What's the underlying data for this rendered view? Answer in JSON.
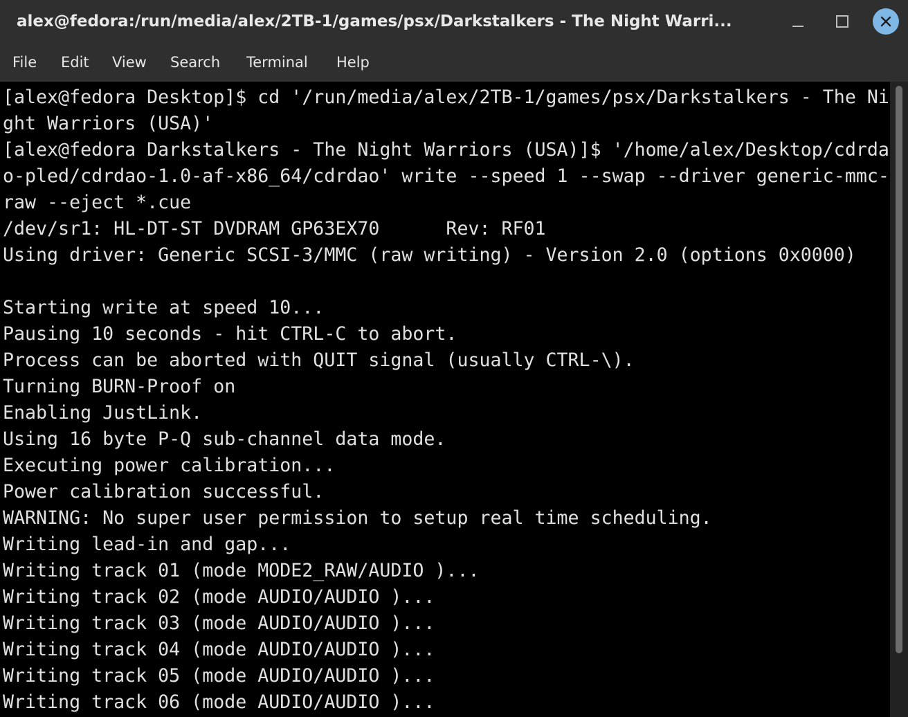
{
  "window": {
    "title": "alex@fedora:/run/media/alex/2TB-1/games/psx/Darkstalkers - The Night Warri..."
  },
  "menu": {
    "items": [
      "File",
      "Edit",
      "View",
      "Search",
      "Terminal",
      "Help"
    ]
  },
  "terminal": {
    "lines": [
      "[alex@fedora Desktop]$ cd '/run/media/alex/2TB-1/games/psx/Darkstalkers - The Ni",
      "ght Warriors (USA)'",
      "[alex@fedora Darkstalkers - The Night Warriors (USA)]$ '/home/alex/Desktop/cdrda",
      "o-pled/cdrdao-1.0-af-x86_64/cdrdao' write --speed 1 --swap --driver generic-mmc-",
      "raw --eject *.cue",
      "/dev/sr1: HL-DT-ST DVDRAM GP63EX70      Rev: RF01",
      "Using driver: Generic SCSI-3/MMC (raw writing) - Version 2.0 (options 0x0000)",
      "",
      "Starting write at speed 10...",
      "Pausing 10 seconds - hit CTRL-C to abort.",
      "Process can be aborted with QUIT signal (usually CTRL-\\).",
      "Turning BURN-Proof on",
      "Enabling JustLink.",
      "Using 16 byte P-Q sub-channel data mode.",
      "Executing power calibration...",
      "Power calibration successful.",
      "WARNING: No super user permission to setup real time scheduling.",
      "Writing lead-in and gap...",
      "Writing track 01 (mode MODE2_RAW/AUDIO )...",
      "Writing track 02 (mode AUDIO/AUDIO )...",
      "Writing track 03 (mode AUDIO/AUDIO )...",
      "Writing track 04 (mode AUDIO/AUDIO )...",
      "Writing track 05 (mode AUDIO/AUDIO )...",
      "Writing track 06 (mode AUDIO/AUDIO )..."
    ]
  },
  "colors": {
    "titlebar_bg": "#2f2f2f",
    "terminal_bg": "#000000",
    "terminal_fg": "#e0e0e0",
    "close_button": "#7fb7e6"
  },
  "icons": {
    "minimize": "minimize-icon",
    "maximize": "maximize-icon",
    "close": "close-icon"
  }
}
